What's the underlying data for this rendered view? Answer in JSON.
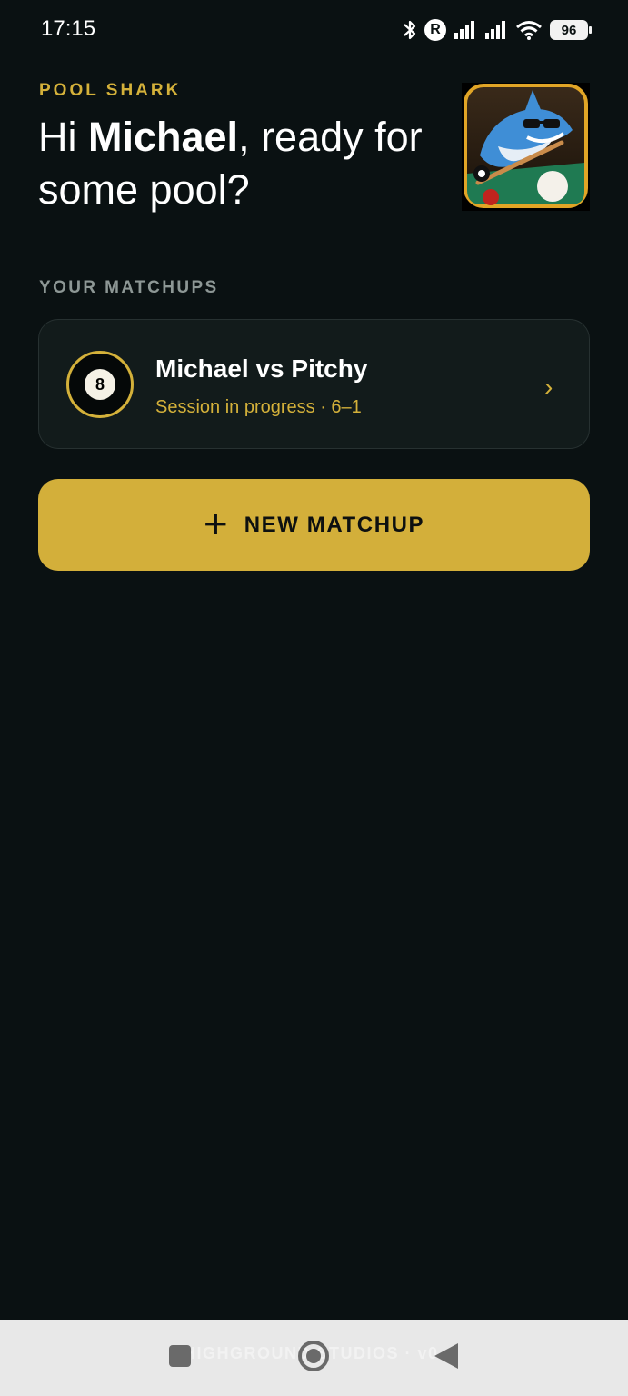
{
  "status_bar": {
    "time": "17:15",
    "battery": "96",
    "icons": [
      "bluetooth-icon",
      "r-badge-icon",
      "signal-icon",
      "signal-icon",
      "wifi-icon",
      "battery-icon"
    ]
  },
  "header": {
    "brand": "POOL SHARK",
    "greeting_prefix": "Hi ",
    "user_name": "Michael",
    "greeting_suffix": ", ready for some pool?"
  },
  "matchups_section": {
    "label": "YOUR MATCHUPS",
    "items": [
      {
        "title": "Michael vs Pitchy",
        "subtitle": "Session in progress · 6–1",
        "ball_number": "8",
        "chevron": "›"
      }
    ]
  },
  "new_matchup_button": {
    "icon": "+",
    "label": "NEW MATCHUP"
  },
  "footer": {
    "text": "HIGHGROUND STUDIOS · v0."
  },
  "colors": {
    "background": "#0a1112",
    "accent": "#d4b13a",
    "card": "#121b1b",
    "muted": "#8d9795"
  }
}
